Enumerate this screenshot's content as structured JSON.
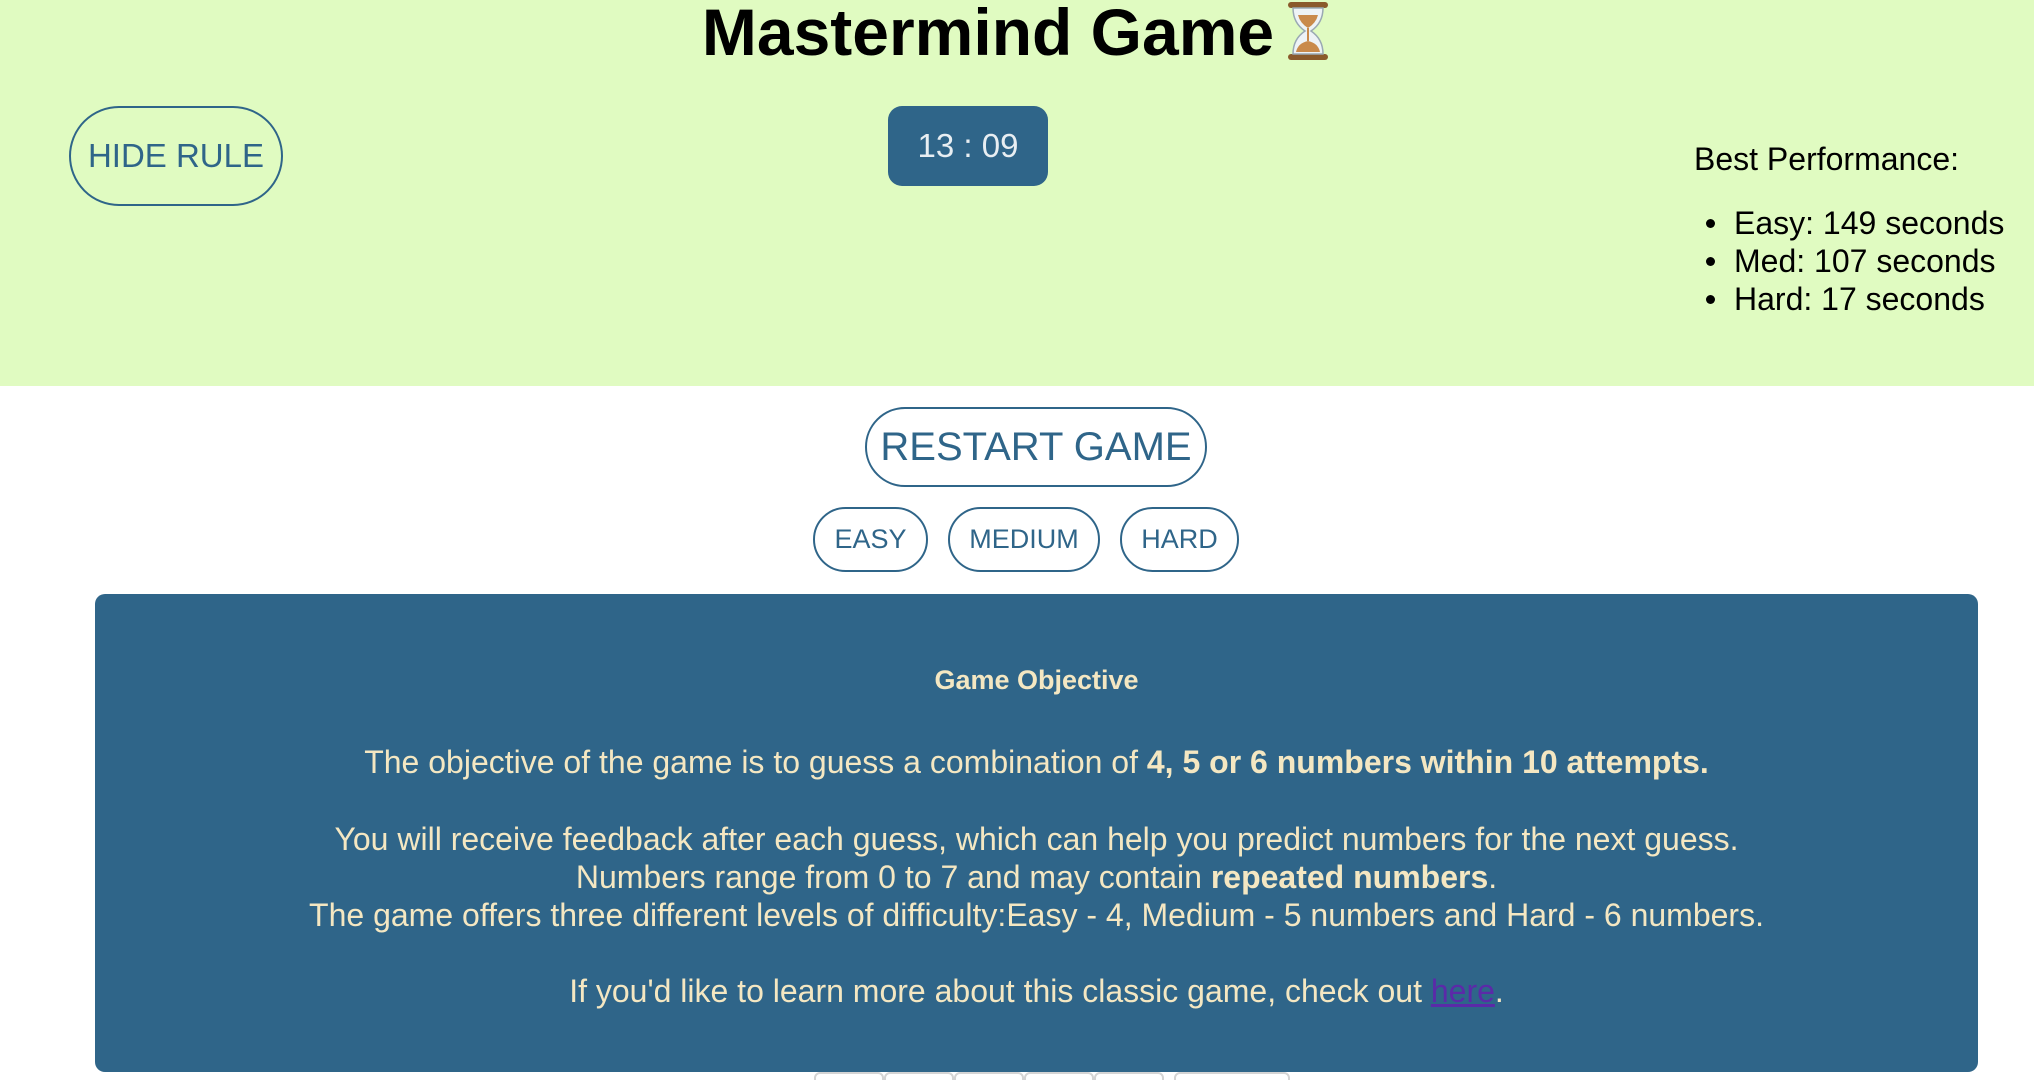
{
  "header": {
    "title": "Mastermind Game",
    "hide_rule_label": "HIDE RULE",
    "timer": "13 : 09",
    "best_performance": {
      "title": "Best Performance:",
      "items": [
        "Easy: 149 seconds",
        "Med: 107 seconds",
        "Hard: 17 seconds"
      ]
    }
  },
  "controls": {
    "restart_label": "RESTART GAME",
    "levels": [
      "EASY",
      "MEDIUM",
      "HARD"
    ]
  },
  "rules": {
    "heading": "Game Objective",
    "line1_text": "The objective of the game is to guess a combination of ",
    "line1_bold": "4, 5 or 6 numbers within 10 attempts.",
    "line2": "You will receive feedback after each guess, which can help you predict numbers for the next guess.",
    "line3_text": "Numbers range from 0 to 7 and may contain ",
    "line3_bold": "repeated numbers",
    "line3_end": ".",
    "line4": "The game offers three different levels of difficulty:Easy - 4, Medium - 5 numbers and Hard - 6 numbers.",
    "line5_text": "If you'd like to learn more about this classic game, check out ",
    "line5_link": "here",
    "line5_end": "."
  },
  "colors": {
    "header_bg": "#e0fbc1",
    "accent": "#2f6589",
    "rules_text": "#f4e7c2",
    "link": "#5b2aa8"
  },
  "icons": {
    "title_icon": "hourglass-icon"
  }
}
